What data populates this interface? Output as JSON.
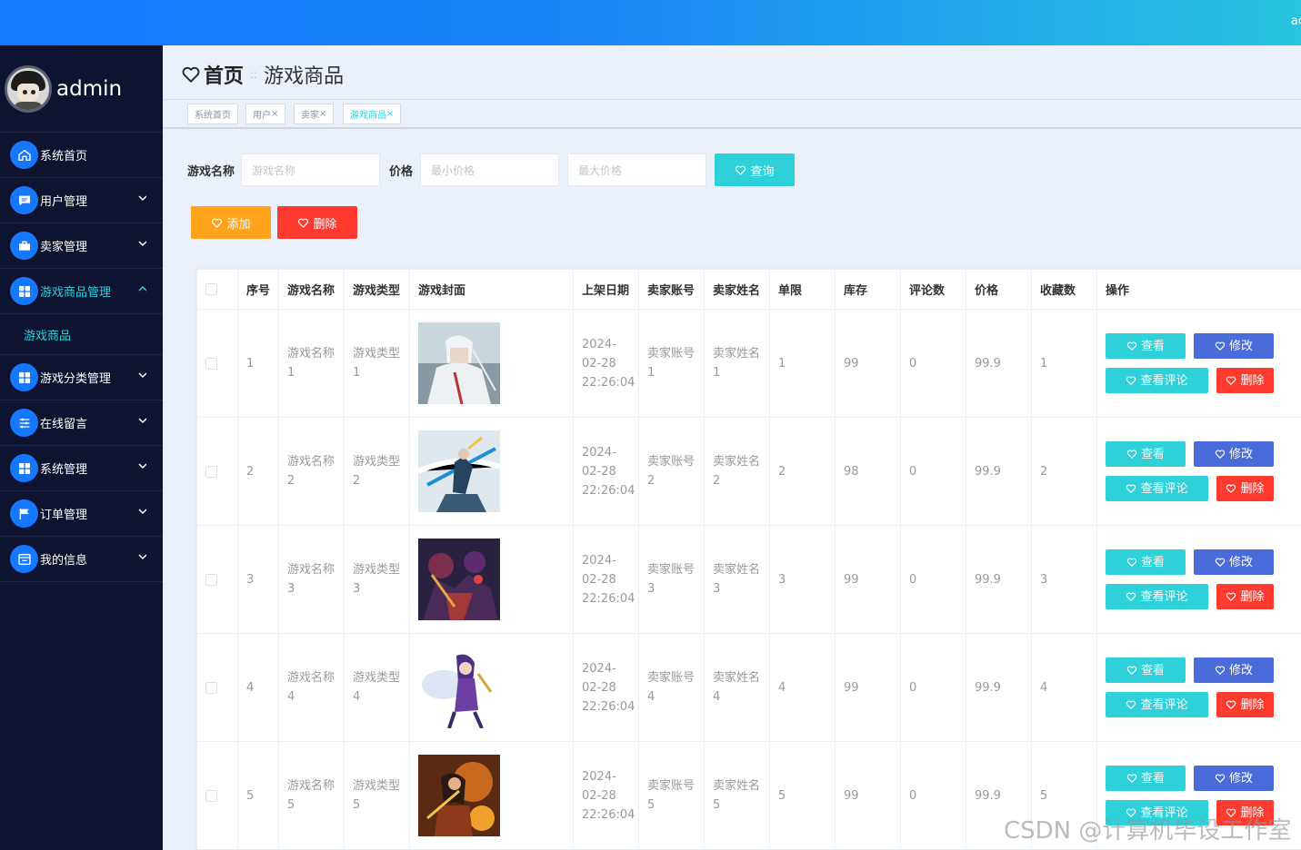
{
  "topbar": {
    "user_text": "ac"
  },
  "sidebar": {
    "username": "admin",
    "items": [
      {
        "label": "系统首页",
        "icon": "home-icon",
        "expandable": false
      },
      {
        "label": "用户管理",
        "icon": "chat-icon",
        "expandable": true
      },
      {
        "label": "卖家管理",
        "icon": "briefcase-icon",
        "expandable": true
      },
      {
        "label": "游戏商品管理",
        "icon": "grid-icon",
        "expandable": true,
        "expanded": true,
        "active": true
      },
      {
        "label": "游戏商品",
        "submenu": true
      },
      {
        "label": "游戏分类管理",
        "icon": "grid-icon",
        "expandable": true
      },
      {
        "label": "在线留言",
        "icon": "sliders-icon",
        "expandable": true
      },
      {
        "label": "系统管理",
        "icon": "grid-icon",
        "expandable": true
      },
      {
        "label": "订单管理",
        "icon": "flag-icon",
        "expandable": true
      },
      {
        "label": "我的信息",
        "icon": "window-icon",
        "expandable": true
      }
    ]
  },
  "header": {
    "home": "首页",
    "separator": "::",
    "current": "游戏商品"
  },
  "tags": [
    {
      "label": "系统首页",
      "closable": false
    },
    {
      "label": "用户",
      "closable": true
    },
    {
      "label": "卖家",
      "closable": true
    },
    {
      "label": "游戏商品",
      "closable": true,
      "active": true
    }
  ],
  "tag_close_glyph": "×",
  "search": {
    "name_label": "游戏名称",
    "name_placeholder": "游戏名称",
    "price_label": "价格",
    "min_placeholder": "最小价格",
    "max_placeholder": "最大价格",
    "query_button": "查询"
  },
  "actions": {
    "add": "添加",
    "delete": "删除"
  },
  "table": {
    "columns": [
      "序号",
      "游戏名称",
      "游戏类型",
      "游戏封面",
      "上架日期",
      "卖家账号",
      "卖家姓名",
      "单限",
      "库存",
      "评论数",
      "价格",
      "收藏数",
      "操作"
    ],
    "row_buttons": {
      "view": "查看",
      "edit": "修改",
      "comments": "查看评论",
      "delete": "删除"
    },
    "rows": [
      {
        "index": "1",
        "name": "游戏名称1",
        "type": "游戏类型1",
        "date": "2024-02-28 22:26:04",
        "seller_account": "卖家账号1",
        "seller_name": "卖家姓名1",
        "limit": "1",
        "stock": "99",
        "comments": "0",
        "price": "99.9",
        "favorites": "1",
        "cover": "white-haired-swordsman"
      },
      {
        "index": "2",
        "name": "游戏名称2",
        "type": "游戏类型2",
        "date": "2024-02-28 22:26:04",
        "seller_account": "卖家账号2",
        "seller_name": "卖家姓名2",
        "limit": "2",
        "stock": "98",
        "comments": "0",
        "price": "99.9",
        "favorites": "2",
        "cover": "sword-slash-hero"
      },
      {
        "index": "3",
        "name": "游戏名称3",
        "type": "游戏类型3",
        "date": "2024-02-28 22:26:04",
        "seller_account": "卖家账号3",
        "seller_name": "卖家姓名3",
        "limit": "3",
        "stock": "99",
        "comments": "0",
        "price": "99.9",
        "favorites": "3",
        "cover": "dark-warriors-group"
      },
      {
        "index": "4",
        "name": "游戏名称4",
        "type": "游戏类型4",
        "date": "2024-02-28 22:26:04",
        "seller_account": "卖家账号4",
        "seller_name": "卖家姓名4",
        "limit": "4",
        "stock": "99",
        "comments": "0",
        "price": "99.9",
        "favorites": "4",
        "cover": "purple-haired-fighter"
      },
      {
        "index": "5",
        "name": "游戏名称5",
        "type": "游戏类型5",
        "date": "2024-02-28 22:26:04",
        "seller_account": "卖家账号5",
        "seller_name": "卖家姓名5",
        "limit": "5",
        "stock": "99",
        "comments": "0",
        "price": "99.9",
        "favorites": "5",
        "cover": "fiery-warrior"
      }
    ]
  },
  "watermark": "CSDN @计算机毕设工作室",
  "colors": {
    "topbar_start": "#1677ff",
    "topbar_end": "#28c4e0",
    "sidebar_bg": "#0e1430",
    "accent": "#2ed1e0",
    "add_button": "#ffa21c",
    "delete_button": "#ff3b30",
    "view_button": "#2ed1d9",
    "edit_button": "#4a6cdb"
  }
}
